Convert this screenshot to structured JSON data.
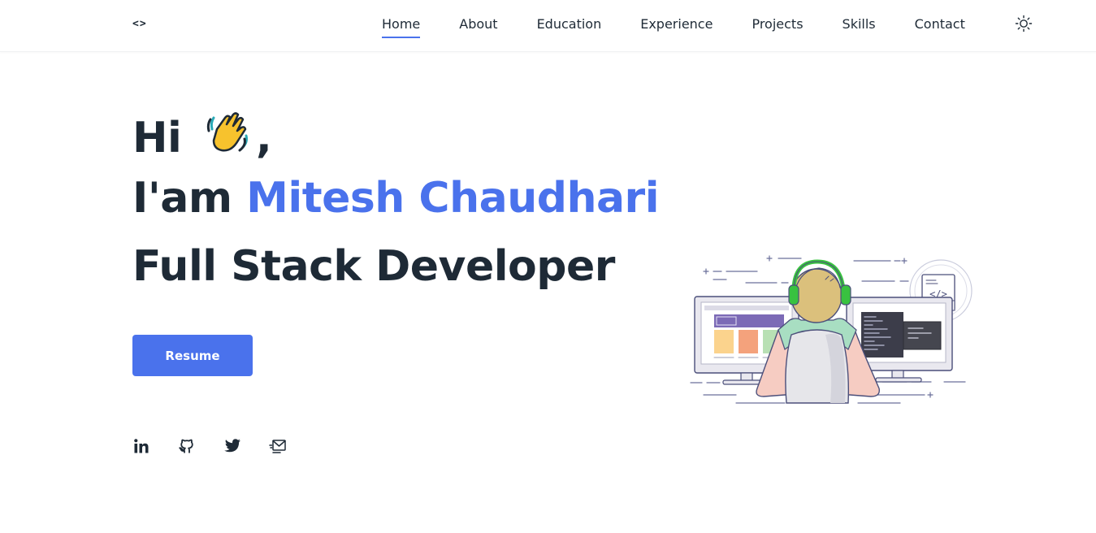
{
  "nav": {
    "logo": "<>",
    "links": [
      "Home",
      "About",
      "Education",
      "Experience",
      "Projects",
      "Skills",
      "Contact"
    ],
    "active": "Home",
    "theme_icon": "sun-icon"
  },
  "hero": {
    "greeting": "Hi",
    "greeting_suffix": ",",
    "wave_icon": "waving-hand-icon",
    "intro_prefix": "I'am",
    "name": "Mitesh Chaudhari",
    "role": "Full Stack Developer",
    "resume_label": "Resume"
  },
  "socials": [
    "linkedin-icon",
    "github-icon",
    "twitter-icon",
    "email-icon"
  ],
  "colors": {
    "accent": "#4a72ec",
    "text": "#1e2a36",
    "background": "#ffffff"
  }
}
